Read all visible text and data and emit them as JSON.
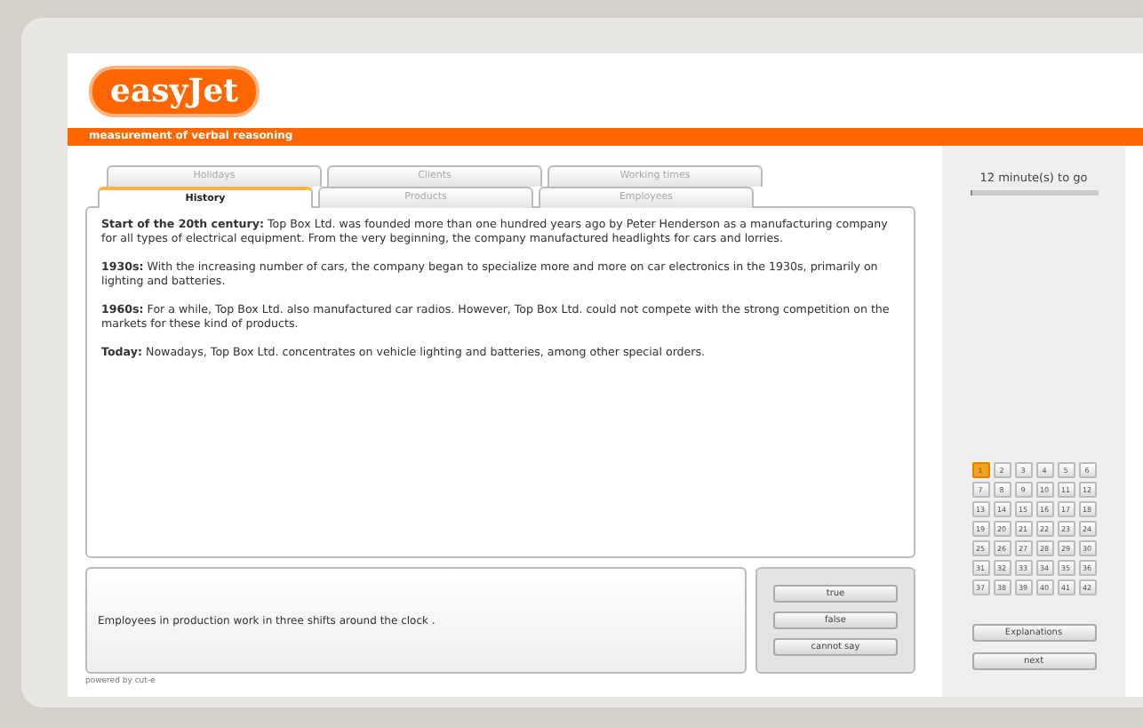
{
  "header": {
    "logo": "easyJet",
    "subtitle": "measurement of verbal reasoning"
  },
  "tabs": [
    [
      {
        "label": "Holidays",
        "selected": false
      },
      {
        "label": "Clients",
        "selected": false
      },
      {
        "label": "Working times",
        "selected": false
      }
    ],
    [
      {
        "label": "History",
        "selected": true
      },
      {
        "label": "Products",
        "selected": false
      },
      {
        "label": "Employees",
        "selected": false
      }
    ]
  ],
  "paragraphs": [
    "**Start of the 20th century:** Top Box Ltd. was founded more than one hundred years ago by Peter Henderson as a manufacturing company for all types of electrical equipment. From the very beginning, the company manufactured headlights for cars and lorries.",
    "**1930s:** With the increasing number of cars, the company began to specialize more and more on car electronics in the 1930s, primarily on lighting and batteries.",
    "**1960s:** For a while, Top Box Ltd. also manufactured car radios. However, Top Box Ltd. could not compete with the strong competition on the markets for these kind of products.",
    "**Today:** Nowadays, Top Box Ltd. concentrates on vehicle lighting and batteries, among other special orders."
  ],
  "statement": "Employees in production work in three shifts around the clock .",
  "answers": [
    "true",
    "false",
    "cannot say"
  ],
  "footer": "powered by cut-e",
  "timer": {
    "text": "12 minute(s) to go",
    "level": 0.02
  },
  "questions": [
    {
      "label": "1",
      "selected": true
    },
    {
      "label": "2",
      "selected": false
    },
    {
      "label": "3",
      "selected": false
    },
    {
      "label": "4",
      "selected": false
    },
    {
      "label": "5",
      "selected": false
    },
    {
      "label": "6",
      "selected": false
    },
    {
      "label": "7",
      "selected": false
    },
    {
      "label": "8",
      "selected": false
    },
    {
      "label": "9",
      "selected": false
    },
    {
      "label": "10",
      "selected": false
    },
    {
      "label": "11",
      "selected": false
    },
    {
      "label": "12",
      "selected": false
    },
    {
      "label": "13",
      "selected": false
    },
    {
      "label": "14",
      "selected": false
    },
    {
      "label": "15",
      "selected": false
    },
    {
      "label": "16",
      "selected": false
    },
    {
      "label": "17",
      "selected": false
    },
    {
      "label": "18",
      "selected": false
    },
    {
      "label": "19",
      "selected": false
    },
    {
      "label": "20",
      "selected": false
    },
    {
      "label": "21",
      "selected": false
    },
    {
      "label": "22",
      "selected": false
    },
    {
      "label": "23",
      "selected": false
    },
    {
      "label": "24",
      "selected": false
    },
    {
      "label": "25",
      "selected": false
    },
    {
      "label": "26",
      "selected": false
    },
    {
      "label": "27",
      "selected": false
    },
    {
      "label": "28",
      "selected": false
    },
    {
      "label": "29",
      "selected": false
    },
    {
      "label": "30",
      "selected": false
    },
    {
      "label": "31",
      "selected": false
    },
    {
      "label": "32",
      "selected": false
    },
    {
      "label": "33",
      "selected": false
    },
    {
      "label": "34",
      "selected": false
    },
    {
      "label": "35",
      "selected": false
    },
    {
      "label": "36",
      "selected": false
    },
    {
      "label": "37",
      "selected": false
    },
    {
      "label": "38",
      "selected": false
    },
    {
      "label": "39",
      "selected": false
    },
    {
      "label": "40",
      "selected": false
    },
    {
      "label": "41",
      "selected": false
    },
    {
      "label": "42",
      "selected": false
    }
  ],
  "side_buttons": [
    "Explanations",
    "next"
  ]
}
